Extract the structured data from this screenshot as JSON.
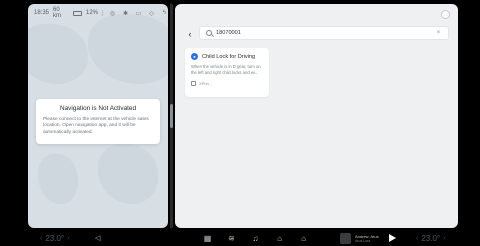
{
  "status_bar": {
    "time": "18:35",
    "range": "60 km",
    "battery_pct": "12%",
    "icons": [
      "signal-icon",
      "bluetooth-icon",
      "camera-icon",
      "location-icon",
      "flash-icon"
    ]
  },
  "navigation_notice": {
    "title": "Navigation is Not Activated",
    "message": "Please connect to the internet at the vehicle sales location. Open navigation app, and it will be automatically activated."
  },
  "search": {
    "value": "18070001",
    "clear_icon": "close-icon"
  },
  "results": [
    {
      "title": "Child Lock for Driving",
      "description": "When the vehicle is in D gear, turn on the left and right child locks and wi...",
      "footer": "XPhn..."
    }
  ],
  "dock": {
    "temp_left": "23.0°",
    "temp_right": "23.0°",
    "media_title": "Andrew, Arus",
    "media_subtitle": "Arus Lora"
  },
  "colors": {
    "accent": "#2f6fe0",
    "map_bg": "#d7dee4",
    "panel_bg": "#eef0f2"
  }
}
